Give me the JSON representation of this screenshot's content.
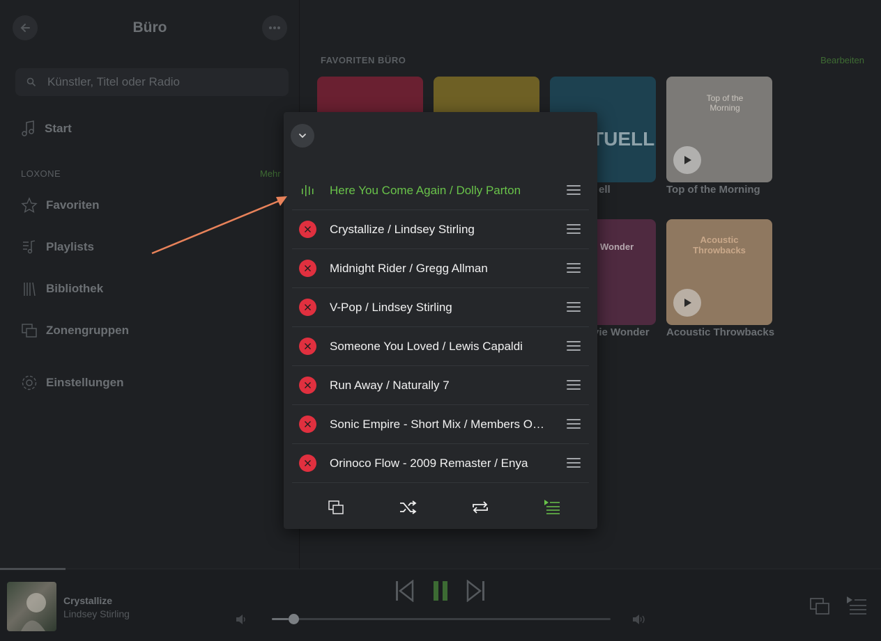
{
  "colors": {
    "accent": "#69c34a",
    "remove": "#e0303f",
    "popup_bg": "#25272a",
    "annotation_arrow": "#e8825a"
  },
  "sidebar": {
    "title": "Büro",
    "search_placeholder": "Künstler, Titel oder Radio",
    "start_label": "Start",
    "section_label": "LOXONE",
    "section_more": "Mehr",
    "items": [
      {
        "label": "Favoriten",
        "icon": "star-icon"
      },
      {
        "label": "Playlists",
        "icon": "playlist-icon"
      },
      {
        "label": "Bibliothek",
        "icon": "library-icon"
      },
      {
        "label": "Zonengruppen",
        "icon": "zone-group-icon"
      }
    ],
    "settings_label": "Einstellungen"
  },
  "main": {
    "favorites_label": "FAVORITEN BÜRO",
    "edit_label": "Bearbeiten",
    "tiles": [
      {
        "caption": "",
        "color": "#7a2436"
      },
      {
        "caption": "",
        "color": "#7a6b2a"
      },
      {
        "caption": "ell",
        "tile_text": "TUELL",
        "color": "#1f4a59"
      },
      {
        "caption": "Top of the Morning",
        "tile_text": "Top of the Morning",
        "color": "#8a8784"
      },
      {
        "caption": "vie Wonder",
        "tile_text": "Wonder",
        "color": "#5a2f4a"
      },
      {
        "caption": "Acoustic Throwbacks",
        "tile_text": "Acoustic Throwbacks",
        "color": "#a58a6f"
      }
    ]
  },
  "queue": {
    "items": [
      {
        "title": "Here You Come Again / Dolly Parton",
        "current": true
      },
      {
        "title": "Crystallize / Lindsey Stirling",
        "current": false
      },
      {
        "title": "Midnight Rider / Gregg Allman",
        "current": false
      },
      {
        "title": "V-Pop / Lindsey Stirling",
        "current": false
      },
      {
        "title": "Someone You Loved / Lewis Capaldi",
        "current": false
      },
      {
        "title": "Run Away / Naturally 7",
        "current": false
      },
      {
        "title": "Sonic Empire - Short Mix / Members O…",
        "current": false
      },
      {
        "title": "Orinoco Flow - 2009 Remaster / Enya",
        "current": false
      }
    ]
  },
  "player": {
    "title": "Crystallize",
    "artist": "Lindsey Stirling",
    "volume_fraction": 0.05,
    "track_progress_fraction": 0.074
  }
}
